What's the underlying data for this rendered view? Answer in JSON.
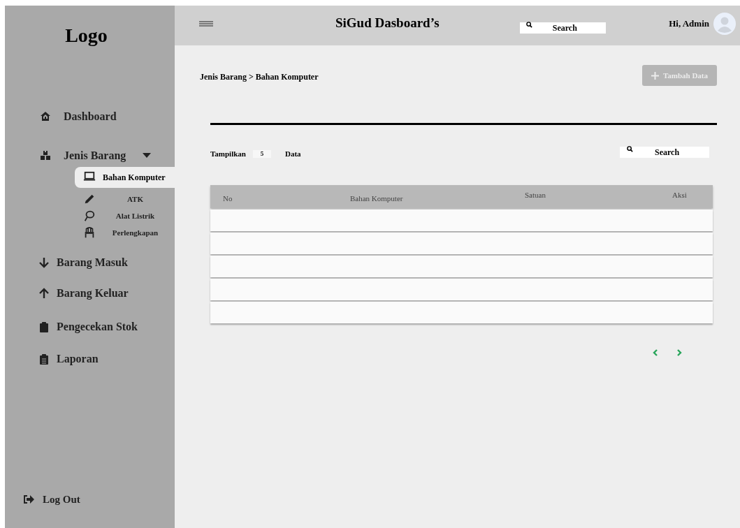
{
  "sidebar": {
    "logo": "Logo",
    "items": [
      {
        "label": "Dashboard"
      },
      {
        "label": "Jenis Barang",
        "expanded": true,
        "children": [
          {
            "label": "Bahan Komputer",
            "selected": true
          },
          {
            "label": "ATK",
            "selected": false
          },
          {
            "label": "Alat Listrik",
            "selected": false
          },
          {
            "label": "Perlengkapan",
            "selected": false
          }
        ]
      },
      {
        "label": "Barang Masuk"
      },
      {
        "label": "Barang Keluar"
      },
      {
        "label": "Pengecekan Stok"
      },
      {
        "label": "Laporan"
      }
    ],
    "logout": "Log Out"
  },
  "header": {
    "title": "SiGud Dasboard’s",
    "search": {
      "placeholder": "Search"
    },
    "greeting": "Hi, Admin"
  },
  "breadcrumb": "Jenis Barang > Bahan Komputer",
  "add_button": {
    "label": "Tambah Data",
    "disabled": true
  },
  "table_controls": {
    "show_label": "Tampilkan",
    "page_size": "5",
    "suffix": "Data",
    "search": {
      "placeholder": "Search"
    }
  },
  "table": {
    "columns": [
      "No",
      "Bahan Komputer",
      "Satuan",
      "Aksi"
    ],
    "rows": [
      {
        "empty": true
      },
      {
        "empty": true
      },
      {
        "empty": true
      },
      {
        "empty": true
      },
      {
        "empty": true
      }
    ]
  }
}
